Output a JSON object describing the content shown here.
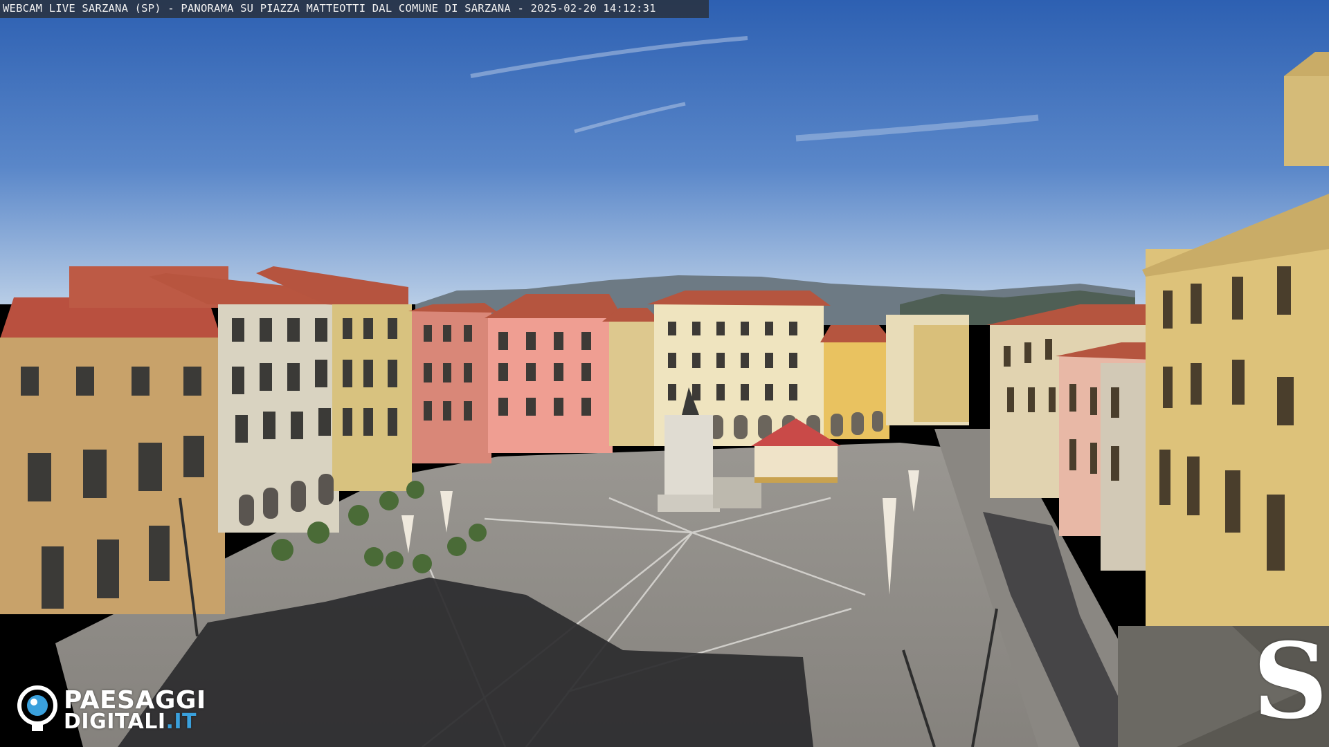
{
  "caption": "WEBCAM LIVE SARZANA (SP) - PANORAMA SU PIAZZA MATTEOTTI DAL COMUNE DI SARZANA - 2025-02-20  14:12:31",
  "logo": {
    "line1": "PAESAGGI",
    "line2_main": "DIGITALI",
    "line2_tld": ".IT",
    "icon": "camera-eye-icon"
  },
  "brand_mark": "S",
  "colors": {
    "sky_top": "#2f63b6",
    "sky_bottom": "#a9c3e4",
    "pavement": "#8f8c88",
    "shadow": "#2a2a2c",
    "logo_accent": "#3aa0dc"
  }
}
